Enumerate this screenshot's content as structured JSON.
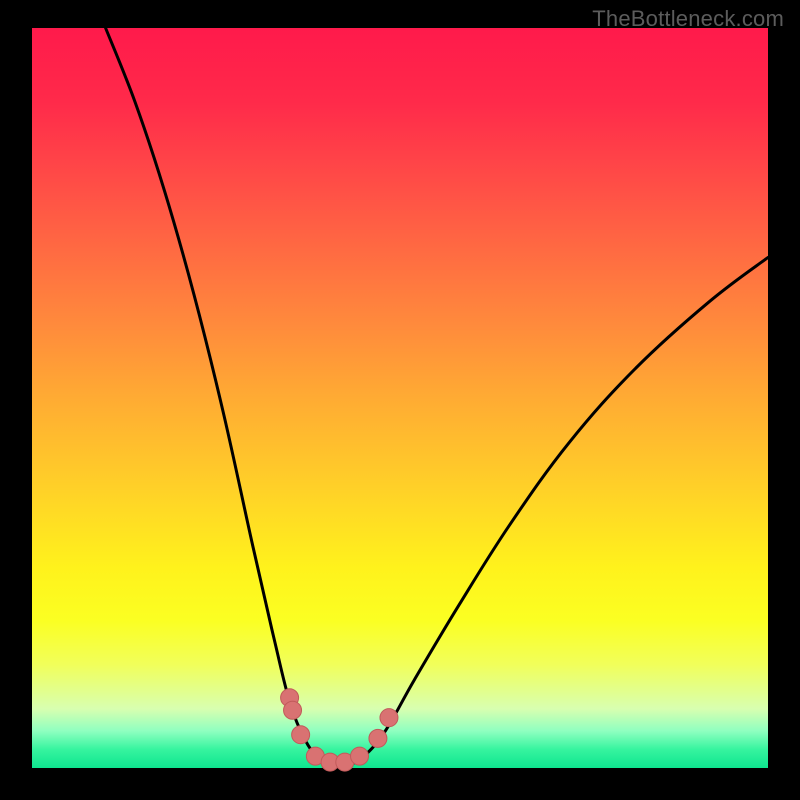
{
  "watermark": "TheBottleneck.com",
  "colors": {
    "frame": "#000000",
    "curve_stroke": "#000000",
    "marker_fill": "#d97272",
    "marker_stroke": "#c15a5a"
  },
  "chart_data": {
    "type": "line",
    "title": "",
    "xlabel": "",
    "ylabel": "",
    "xlim": [
      0,
      100
    ],
    "ylim": [
      0,
      100
    ],
    "grid": false,
    "legend": false,
    "curve": [
      {
        "x": 10,
        "y": 100
      },
      {
        "x": 14,
        "y": 90
      },
      {
        "x": 18,
        "y": 78
      },
      {
        "x": 22,
        "y": 64
      },
      {
        "x": 26,
        "y": 48
      },
      {
        "x": 30,
        "y": 30
      },
      {
        "x": 33,
        "y": 17
      },
      {
        "x": 35,
        "y": 9
      },
      {
        "x": 37,
        "y": 4
      },
      {
        "x": 39,
        "y": 1.2
      },
      {
        "x": 41,
        "y": 0.5
      },
      {
        "x": 43,
        "y": 0.5
      },
      {
        "x": 45,
        "y": 1.5
      },
      {
        "x": 48,
        "y": 5
      },
      {
        "x": 52,
        "y": 12
      },
      {
        "x": 58,
        "y": 22
      },
      {
        "x": 65,
        "y": 33
      },
      {
        "x": 73,
        "y": 44
      },
      {
        "x": 82,
        "y": 54
      },
      {
        "x": 92,
        "y": 63
      },
      {
        "x": 100,
        "y": 69
      }
    ],
    "markers": [
      {
        "x": 35.0,
        "y": 9.5
      },
      {
        "x": 35.4,
        "y": 7.8
      },
      {
        "x": 36.5,
        "y": 4.5
      },
      {
        "x": 38.5,
        "y": 1.6
      },
      {
        "x": 40.5,
        "y": 0.8
      },
      {
        "x": 42.5,
        "y": 0.8
      },
      {
        "x": 44.5,
        "y": 1.6
      },
      {
        "x": 47.0,
        "y": 4.0
      },
      {
        "x": 48.5,
        "y": 6.8
      }
    ]
  }
}
